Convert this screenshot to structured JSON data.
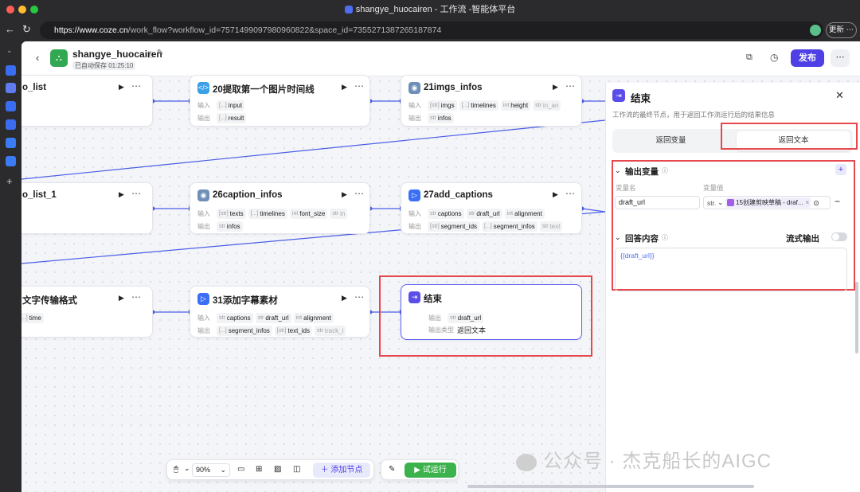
{
  "window": {
    "title": "shangye_huocairen - 工作流 -智能体平台"
  },
  "browser": {
    "url_host": "https://www.coze.cn",
    "url_path": "/work_flow?workflow_id=7571499097980960822&space_id=7355271387265187874",
    "update_label": "更新"
  },
  "header": {
    "app_name": "shangye_huocairen",
    "autosave": "已自动保存 01:25:10",
    "publish_label": "发布"
  },
  "nodes": {
    "n1": {
      "title": "o_list"
    },
    "n2": {
      "title": "20提取第一个图片时间线",
      "in_label": "输入",
      "out_label": "输出",
      "inputs": [
        {
          "type": "[...]",
          "name": "input"
        }
      ],
      "outputs": [
        {
          "type": "[...]",
          "name": "result"
        }
      ]
    },
    "n3": {
      "title": "21imgs_infos",
      "in_label": "输入",
      "out_label": "输出",
      "inputs": [
        {
          "type": "[str]",
          "name": "imgs"
        },
        {
          "type": "[...]",
          "name": "timelines"
        },
        {
          "type": "int",
          "name": "height"
        },
        {
          "type": "str",
          "name": "in_an"
        }
      ],
      "outputs": [
        {
          "type": "str",
          "name": "infos"
        }
      ]
    },
    "n4": {
      "title": "o_list_1"
    },
    "n5": {
      "title": "26caption_infos",
      "in_label": "输入",
      "out_label": "输出",
      "inputs": [
        {
          "type": "[str]",
          "name": "texts"
        },
        {
          "type": "[...]",
          "name": "timelines"
        },
        {
          "type": "int",
          "name": "font_size"
        },
        {
          "type": "str",
          "name": "in"
        }
      ],
      "outputs": [
        {
          "type": "str",
          "name": "infos"
        }
      ]
    },
    "n6": {
      "title": "27add_captions",
      "in_label": "输入",
      "out_label": "输出",
      "inputs": [
        {
          "type": "str",
          "name": "captions"
        },
        {
          "type": "str",
          "name": "draft_url"
        },
        {
          "type": "int",
          "name": "alignment"
        }
      ],
      "outputs": [
        {
          "type": "[str]",
          "name": "segment_ids"
        },
        {
          "type": "[...]",
          "name": "segment_infos"
        },
        {
          "type": "str",
          "name": "text"
        }
      ]
    },
    "n7": {
      "title": "文字传输格式",
      "out_field": {
        "type": "[...]",
        "name": "time"
      }
    },
    "n8": {
      "title": "31添加字幕素材",
      "in_label": "输入",
      "out_label": "输出",
      "inputs": [
        {
          "type": "str",
          "name": "captions"
        },
        {
          "type": "str",
          "name": "draft_url"
        },
        {
          "type": "int",
          "name": "alignment"
        }
      ],
      "outputs": [
        {
          "type": "[...]",
          "name": "segment_infos"
        },
        {
          "type": "[str]",
          "name": "text_ids"
        },
        {
          "type": "str",
          "name": "track_i"
        }
      ]
    },
    "end": {
      "title": "结束",
      "out_label": "输出",
      "out_tag": {
        "type": "str",
        "name": "draft_url"
      },
      "type_label": "输出类型",
      "type_value": "返回文本"
    }
  },
  "toolbar": {
    "zoom": "90%",
    "add_node": "添加节点",
    "test_run": "试运行"
  },
  "panel": {
    "title": "结束",
    "desc": "工作流的最终节点，用于返回工作流运行后的结果信息",
    "tab_var": "返回变量",
    "tab_text": "返回文本",
    "output_section": "输出变量",
    "col_name": "变量名",
    "col_value": "变量值",
    "var_name": "draft_url",
    "var_type": "str.",
    "var_ref": "15创建剪映草稿 - draf...",
    "answer_section": "回答内容",
    "stream_label": "流式输出",
    "answer_text": "{{draft_url}}"
  },
  "watermark": "公众号 · 杰克船长的AIGC",
  "colors": {
    "accent": "#4e40e5",
    "highlight": "#e5484d",
    "run": "#3bb24b"
  }
}
